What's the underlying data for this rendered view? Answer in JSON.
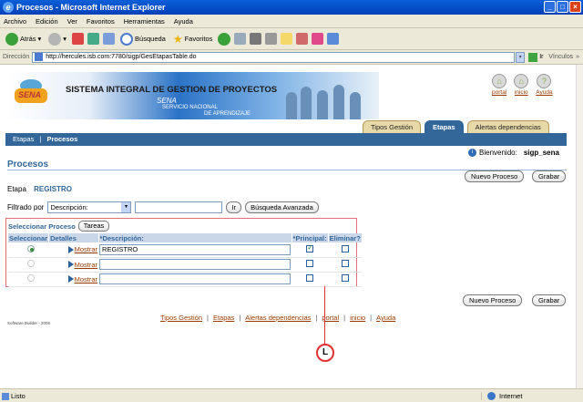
{
  "window": {
    "title": "Procesos - Microsoft Internet Explorer"
  },
  "menu": [
    "Archivo",
    "Edición",
    "Ver",
    "Favoritos",
    "Herramientas",
    "Ayuda"
  ],
  "toolbar": {
    "back": "Atrás",
    "search": "Búsqueda",
    "favorites": "Favoritos"
  },
  "address": {
    "label": "Dirección",
    "url": "http://hercules.isb.com:7780/sigp/GesEtapasTable.do",
    "go": "Ir",
    "links": "Vínculos"
  },
  "banner": {
    "system_title": "SISTEMA INTEGRAL DE GESTION DE PROYECTOS",
    "logo_text": "SENA",
    "sena": "SENA",
    "servicio": "SERVICIO NACIONAL",
    "aprendizaje": "DE APRENDIZAJE"
  },
  "global_nav": {
    "portal": "portal",
    "inicio": "inicio",
    "ayuda": "Ayuda"
  },
  "tabs": [
    {
      "label": "Tipos Gestión"
    },
    {
      "label": "Etapas"
    },
    {
      "label": "Alertas dependencias"
    }
  ],
  "breadcrumb": {
    "etapas": "Etapas",
    "sep": "|",
    "procesos": "Procesos"
  },
  "welcome": {
    "label": "Bienvenido:",
    "user": "sigp_sena"
  },
  "page": {
    "title": "Procesos",
    "nuevo_proceso": "Nuevo Proceso",
    "grabar": "Grabar"
  },
  "etapa": {
    "label": "Etapa",
    "value": "REGISTRO"
  },
  "filter": {
    "label": "Filtrado por",
    "selected": "Descripción:",
    "go": "Ir",
    "advanced": "Búsqueda Avanzada"
  },
  "table": {
    "select_label": "Seleccionar Proceso",
    "tareas_button": "Tareas",
    "headers": {
      "select": "Seleccionar",
      "details": "Detalles",
      "description": "*Descripción:",
      "principal": "*Principal:",
      "delete": "Eliminar?"
    },
    "detail_link": "Mostrar",
    "rows": [
      {
        "selected": true,
        "description": "REGISTRO",
        "principal": true,
        "delete": false
      },
      {
        "selected": false,
        "description": "",
        "principal": false,
        "delete": false
      },
      {
        "selected": false,
        "description": "",
        "principal": false,
        "delete": false
      }
    ]
  },
  "footer": {
    "links": [
      "Tipos Gestión",
      "Etapas",
      "Alertas dependencias",
      "portal",
      "inicio",
      "Ayuda"
    ],
    "sep": "|",
    "brand": "Software Builder - 2005"
  },
  "callout": {
    "label": "L"
  },
  "status": {
    "text": "Listo",
    "zone": "Internet"
  },
  "colors": {
    "accent": "#336699",
    "link": "#9a3a00",
    "callout": "#e03030",
    "tab_inactive": "#e8d9a8"
  }
}
